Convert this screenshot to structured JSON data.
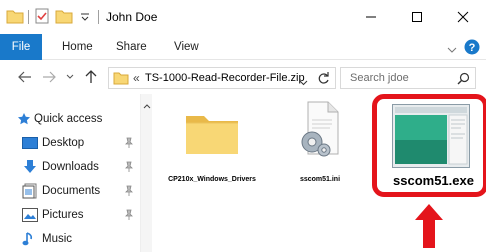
{
  "titlebar": {
    "title": "John Doe",
    "minimize_glyph": "—",
    "maximize_glyph": "☐",
    "close_glyph": "✕"
  },
  "ribbon": {
    "tabs": [
      "File",
      "Home",
      "Share",
      "View"
    ]
  },
  "address": {
    "prefix": "«",
    "path": "TS-1000-Read-Recorder-File.zip"
  },
  "search": {
    "placeholder": "Search jdoe"
  },
  "navpane": {
    "items": [
      {
        "label": "Quick access",
        "icon": "star-icon",
        "pinned": false
      },
      {
        "label": "Desktop",
        "icon": "desktop-icon",
        "pinned": true
      },
      {
        "label": "Downloads",
        "icon": "download-icon",
        "pinned": true
      },
      {
        "label": "Documents",
        "icon": "documents-icon",
        "pinned": true
      },
      {
        "label": "Pictures",
        "icon": "pictures-icon",
        "pinned": true
      },
      {
        "label": "Music",
        "icon": "music-icon",
        "pinned": false
      }
    ]
  },
  "files": [
    {
      "name": "CP210x_Windows_Drivers",
      "icon": "folder-icon"
    },
    {
      "name": "sscom51.ini",
      "icon": "settings-file-icon"
    },
    {
      "name": "sscom51.exe",
      "icon": "application-icon",
      "highlighted": true
    }
  ],
  "colors": {
    "file_tab": "#1979ca",
    "highlight": "#e4141b",
    "arrow": "#e4141b",
    "folder": "#f8d775"
  }
}
